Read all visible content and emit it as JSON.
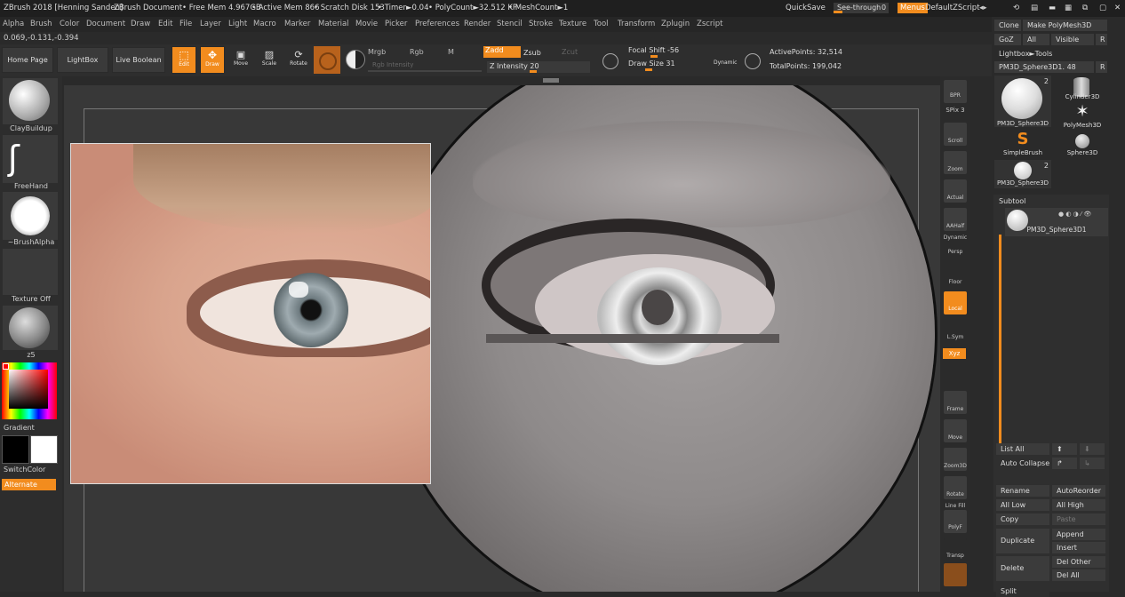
{
  "title_bar": {
    "app": "ZBrush 2018 [Henning Sanden]",
    "document": "ZBrush Document",
    "free_mem": "• Free Mem 4.967GB",
    "active_mem": "• Active Mem 866",
    "scratch": "• Scratch Disk 153",
    "timer": "• Timer►0.04",
    "polycount": "• PolyCount►32.512 KP",
    "meshcount": "• MeshCount►1",
    "quicksave": "QuickSave",
    "see_through": "See-through",
    "see_through_value": "0",
    "menus": "Menus",
    "script": "DefaultZScript"
  },
  "menu": [
    "Alpha",
    "Brush",
    "Color",
    "Document",
    "Draw",
    "Edit",
    "File",
    "Layer",
    "Light",
    "Macro",
    "Marker",
    "Material",
    "Movie",
    "Picker",
    "Preferences",
    "Render",
    "Stencil",
    "Stroke",
    "Texture",
    "Tool",
    "Transform",
    "Zplugin",
    "Zscript"
  ],
  "coords": "0.069,-0.131,-0.394",
  "toolbar": {
    "home": "Home Page",
    "lightbox": "LightBox",
    "live_boolean": "Live Boolean",
    "edit": "Edit",
    "draw": "Draw",
    "move": "Move",
    "scale": "Scale",
    "rotate": "Rotate",
    "mrgb": "Mrgb",
    "rgb": "Rgb",
    "m": "M",
    "rgb_intensity": "Rgb Intensity",
    "zadd": "Zadd",
    "zsub": "Zsub",
    "zcut": "Zcut",
    "z_intensity": "Z Intensity 20",
    "focal_shift": "Focal Shift -56",
    "draw_size": "Draw Size 31",
    "dynamic": "Dynamic",
    "active_points": "ActivePoints: 32,514",
    "total_points": "TotalPoints: 199,042"
  },
  "left_shelf": {
    "brush": "ClayBuildup",
    "stroke": "FreeHand",
    "alpha": "~BrushAlpha",
    "texture": "Texture Off",
    "material": "z5",
    "gradient": "Gradient",
    "switch_color": "SwitchColor",
    "alternate": "Alternate"
  },
  "right_shelf": {
    "bpr": "BPR",
    "spix": "SPix 3",
    "scroll": "Scroll",
    "zoom": "Zoom",
    "actual": "Actual",
    "aahalf": "AAHalf",
    "dynamic": "Dynamic",
    "persp": "Persp",
    "floor": "Floor",
    "local": "Local",
    "lsym": "L.Sym",
    "xyz": "Xyz",
    "frame": "Frame",
    "move": "Move",
    "zoom3d": "Zoom3D",
    "rotate": "Rotate",
    "line_fill": "Line Fill",
    "polyf": "PolyF",
    "transp": "Transp"
  },
  "tool_panel": {
    "clone": "Clone",
    "make_polymesh": "Make PolyMesh3D",
    "goz": "GoZ",
    "all": "All",
    "visible": "Visible",
    "r": "R",
    "lightbox_tools": "Lightbox►Tools",
    "current_tool": "PM3D_Sphere3D1. 48",
    "tools": [
      {
        "label": "PM3D_Sphere3D",
        "badge": "2"
      },
      {
        "label": "Cylinder3D",
        "badge": ""
      },
      {
        "label": "PolyMesh3D",
        "badge": ""
      },
      {
        "label": "SimpleBrush",
        "badge": ""
      },
      {
        "label": "Sphere3D",
        "badge": ""
      },
      {
        "label": "PM3D_Sphere3D",
        "badge": "2"
      }
    ]
  },
  "subtool": {
    "header": "Subtool",
    "item": "PM3D_Sphere3D1",
    "list_all": "List All",
    "auto_collapse": "Auto Collapse",
    "rename": "Rename",
    "auto_reorder": "AutoReorder",
    "all_low": "All Low",
    "all_high": "All High",
    "copy": "Copy",
    "paste": "Paste",
    "duplicate": "Duplicate",
    "append": "Append",
    "insert": "Insert",
    "delete": "Delete",
    "del_other": "Del Other",
    "del_all": "Del All",
    "split": "Split"
  },
  "colors": {
    "accent": "#f28c1e",
    "panel": "#2a2a2a",
    "button": "#3b3b3b"
  }
}
